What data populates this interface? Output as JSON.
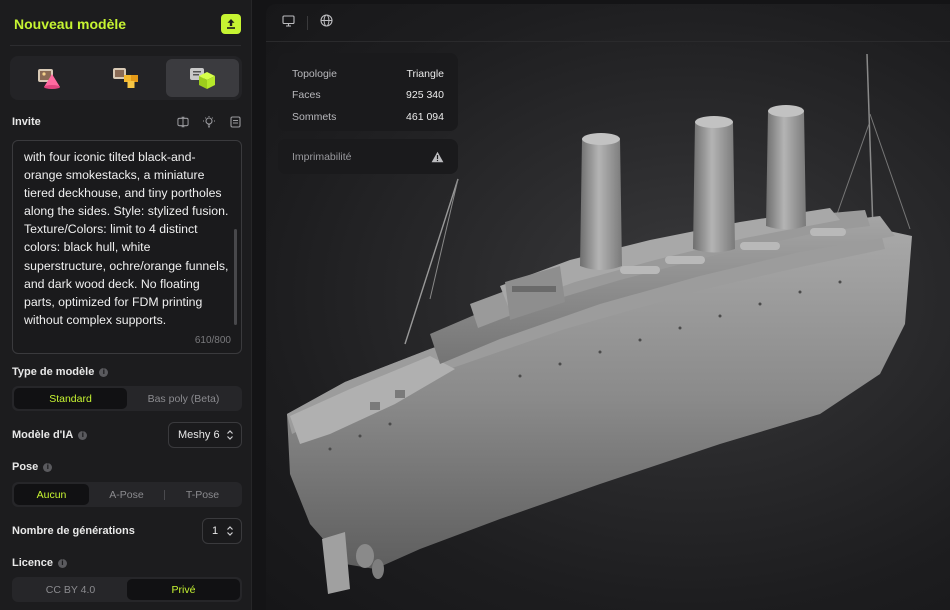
{
  "panel": {
    "title": "Nouveau modèle",
    "modes": [
      {
        "name": "image-cone-mode-icon"
      },
      {
        "name": "multi-image-mode-icon"
      },
      {
        "name": "text-cube-mode-icon"
      }
    ],
    "prompt": {
      "label": "Invite",
      "text": "with four iconic tilted black-and-\norange smokestacks, a miniature\ntiered deckhouse, and tiny portholes\nalong the sides. Style: stylized fusion.\nTexture/Colors: limit to 4 distinct\ncolors: black hull, white\nsuperstructure, ochre/orange funnels,\nand dark wood deck. No floating\nparts, optimized for FDM printing\nwithout complex supports.",
      "count": "610/800"
    },
    "model_type": {
      "label": "Type de modèle",
      "options": [
        "Standard",
        "Bas poly (Beta)"
      ]
    },
    "ai_model": {
      "label": "Modèle d'IA",
      "value": "Meshy 6"
    },
    "pose": {
      "label": "Pose",
      "options": [
        "Aucun",
        "A-Pose",
        "T-Pose"
      ]
    },
    "generations": {
      "label": "Nombre de générations",
      "value": "1"
    },
    "license": {
      "label": "Licence",
      "options": [
        "CC BY 4.0",
        "Privé"
      ]
    }
  },
  "viewport": {
    "stats": [
      {
        "key": "Topologie",
        "value": "Triangle"
      },
      {
        "key": "Faces",
        "value": "925 340"
      },
      {
        "key": "Sommets",
        "value": "461 094"
      }
    ],
    "printability_label": "Imprimabilité"
  },
  "colors": {
    "accent": "#c6f432",
    "panel_bg": "#1c1c1e",
    "viewport_bg": "#2b2b2d"
  }
}
